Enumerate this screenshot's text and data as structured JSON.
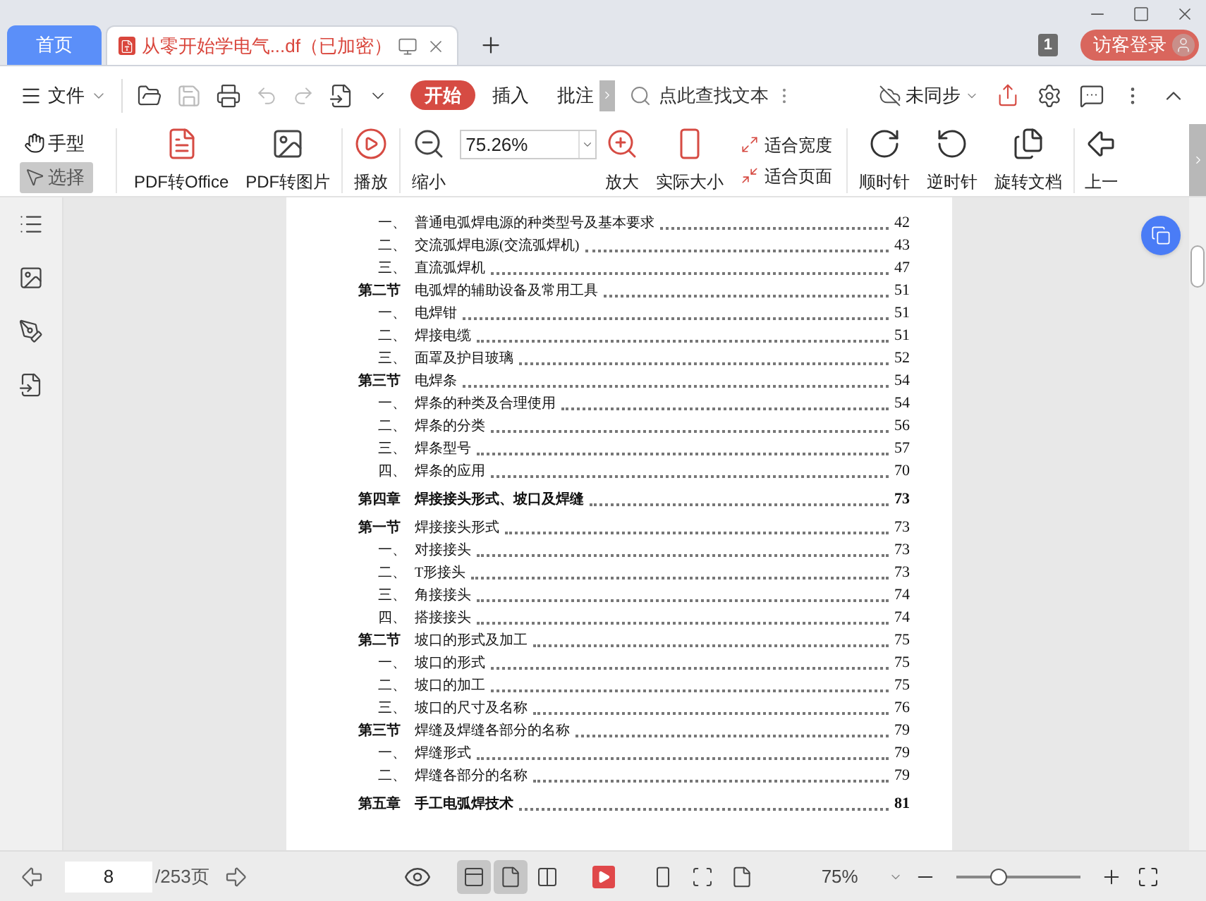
{
  "tabs": [
    {
      "label": "首页",
      "selected": false
    },
    {
      "label": "从零开始学电气...df（已加密）",
      "selected": true
    }
  ],
  "title_bar": {
    "badge": "1",
    "login": "访客登录"
  },
  "menu": {
    "file": "文件",
    "tabs": [
      {
        "label": "开始",
        "selected": true
      },
      {
        "label": "插入",
        "selected": false
      },
      {
        "label": "批注",
        "selected": false
      }
    ],
    "search_placeholder": "点此查找文本",
    "sync": "未同步"
  },
  "ribbon": {
    "modes": [
      {
        "label": "手型",
        "selected": false
      },
      {
        "label": "选择",
        "selected": true
      }
    ],
    "pdf_to_office": "PDF转Office",
    "pdf_to_image": "PDF转图片",
    "play": "播放",
    "zoom_out": "缩小",
    "zoom_value": "75.26%",
    "zoom_in": "放大",
    "actual_size": "实际大小",
    "fit": [
      "适合宽度",
      "适合页面"
    ],
    "clockwise": "顺时针",
    "counterclockwise": "逆时针",
    "rotate_doc": "旋转文档",
    "previous": "上一"
  },
  "toc": [
    {
      "kind": "item",
      "marker": "一、",
      "title": "普通电弧焊电源的种类型号及基本要求",
      "page": "42"
    },
    {
      "kind": "item",
      "marker": "二、",
      "title": "交流弧焊电源(交流弧焊机)",
      "page": "43"
    },
    {
      "kind": "item",
      "marker": "三、",
      "title": "直流弧焊机",
      "page": "47"
    },
    {
      "kind": "section",
      "marker": "第二节",
      "title": "电弧焊的辅助设备及常用工具",
      "page": "51"
    },
    {
      "kind": "item",
      "marker": "一、",
      "title": "电焊钳",
      "page": "51"
    },
    {
      "kind": "item",
      "marker": "二、",
      "title": "焊接电缆",
      "page": "51"
    },
    {
      "kind": "item",
      "marker": "三、",
      "title": "面罩及护目玻璃",
      "page": "52"
    },
    {
      "kind": "section",
      "marker": "第三节",
      "title": "电焊条",
      "page": "54"
    },
    {
      "kind": "item",
      "marker": "一、",
      "title": "焊条的种类及合理使用",
      "page": "54"
    },
    {
      "kind": "item",
      "marker": "二、",
      "title": "焊条的分类",
      "page": "56"
    },
    {
      "kind": "item",
      "marker": "三、",
      "title": "焊条型号",
      "page": "57"
    },
    {
      "kind": "item",
      "marker": "四、",
      "title": "焊条的应用",
      "page": "70"
    },
    {
      "kind": "chapter",
      "marker": "第四章",
      "title": "焊接接头形式、坡口及焊缝",
      "page": "73"
    },
    {
      "kind": "section",
      "marker": "第一节",
      "title": "焊接接头形式",
      "page": "73"
    },
    {
      "kind": "item",
      "marker": "一、",
      "title": "对接接头",
      "page": "73"
    },
    {
      "kind": "item",
      "marker": "二、",
      "title": "T形接头",
      "page": "73"
    },
    {
      "kind": "item",
      "marker": "三、",
      "title": "角接接头",
      "page": "74"
    },
    {
      "kind": "item",
      "marker": "四、",
      "title": "搭接接头",
      "page": "74"
    },
    {
      "kind": "section",
      "marker": "第二节",
      "title": "坡口的形式及加工",
      "page": "75"
    },
    {
      "kind": "item",
      "marker": "一、",
      "title": "坡口的形式",
      "page": "75"
    },
    {
      "kind": "item",
      "marker": "二、",
      "title": "坡口的加工",
      "page": "75"
    },
    {
      "kind": "item",
      "marker": "三、",
      "title": "坡口的尺寸及名称",
      "page": "76"
    },
    {
      "kind": "section",
      "marker": "第三节",
      "title": "焊缝及焊缝各部分的名称",
      "page": "79"
    },
    {
      "kind": "item",
      "marker": "一、",
      "title": "焊缝形式",
      "page": "79"
    },
    {
      "kind": "item",
      "marker": "二、",
      "title": "焊缝各部分的名称",
      "page": "79"
    },
    {
      "kind": "chapter",
      "marker": "第五章",
      "title": "手工电弧焊技术",
      "page": "81"
    }
  ],
  "status_bar": {
    "page": "8",
    "total": "/253页",
    "views": [
      {
        "selected": true
      },
      {
        "selected": true
      },
      {
        "selected": false
      }
    ],
    "zoom": "75%",
    "zoom_slider": {
      "level": 0.34
    }
  }
}
